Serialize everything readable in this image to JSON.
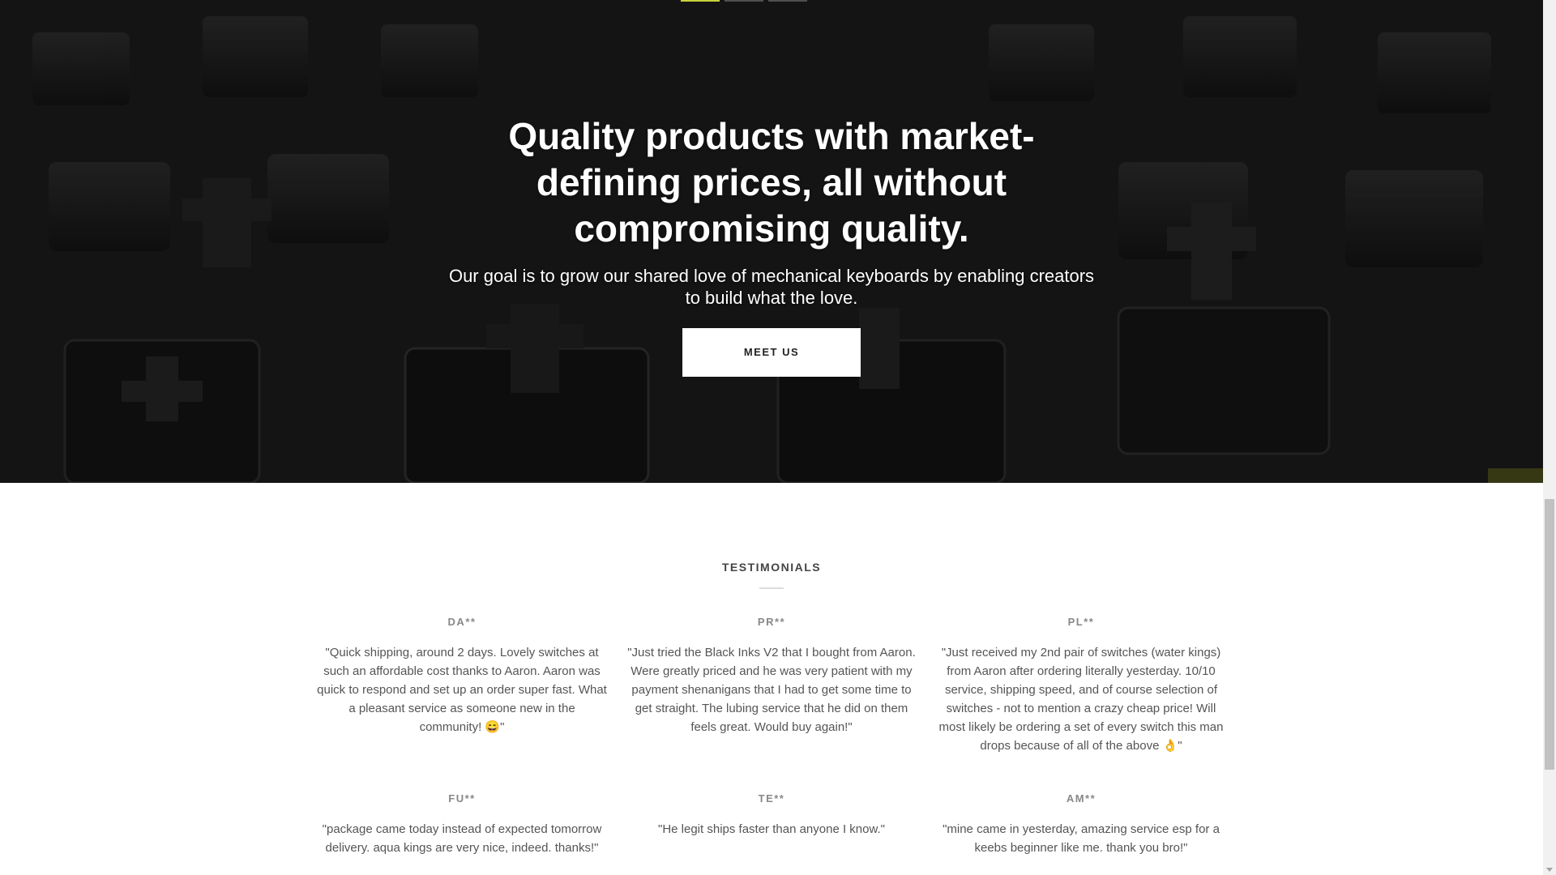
{
  "hero": {
    "title": "Quality products with market-defining prices, all without compromising quality.",
    "subtitle": "Our goal is to grow our shared love of mechanical keyboards by enabling creators to build what the love.",
    "button_label": "MEET US"
  },
  "testimonials": {
    "heading": "TESTIMONIALS",
    "items": [
      {
        "name": "DA**",
        "quote": "\"Quick shipping, around 2 days. Lovely switches at such an affordable cost thanks to Aaron. Aaron was quick to respond and set up an order super fast. What a pleasant service as someone new in the community! 😄\""
      },
      {
        "name": "PR**",
        "quote": "\"Just tried the Black Inks V2 that I bought from Aaron. Were greatly priced and he was very patient with my payment shenanigans that I had to get some time to get straight. The lubing service that he did on them feels great. Would buy again!\""
      },
      {
        "name": "PL**",
        "quote": "\"Just received my 2nd pair of switches (water kings) from Aaron after ordering literally yesterday. 10/10 service, shipping speed, and of course selection of switches - not to mention a crazy cheap price! Will most likely be ordering a set of every switch this man drops because of all of the above 👌\""
      },
      {
        "name": "FU**",
        "quote": "\"package came today instead of expected tomorrow delivery. aqua kings are very nice, indeed. thanks!\""
      },
      {
        "name": "TE**",
        "quote": "\"He legit ships faster than anyone I know.\""
      },
      {
        "name": "AM**",
        "quote": "\"mine came in yesterday, amazing service esp for a keebs beginner like me. thank you bro!\""
      }
    ]
  },
  "colors": {
    "accent": "#c8d23a",
    "text_dark": "#444444",
    "text_muted": "#888888"
  }
}
